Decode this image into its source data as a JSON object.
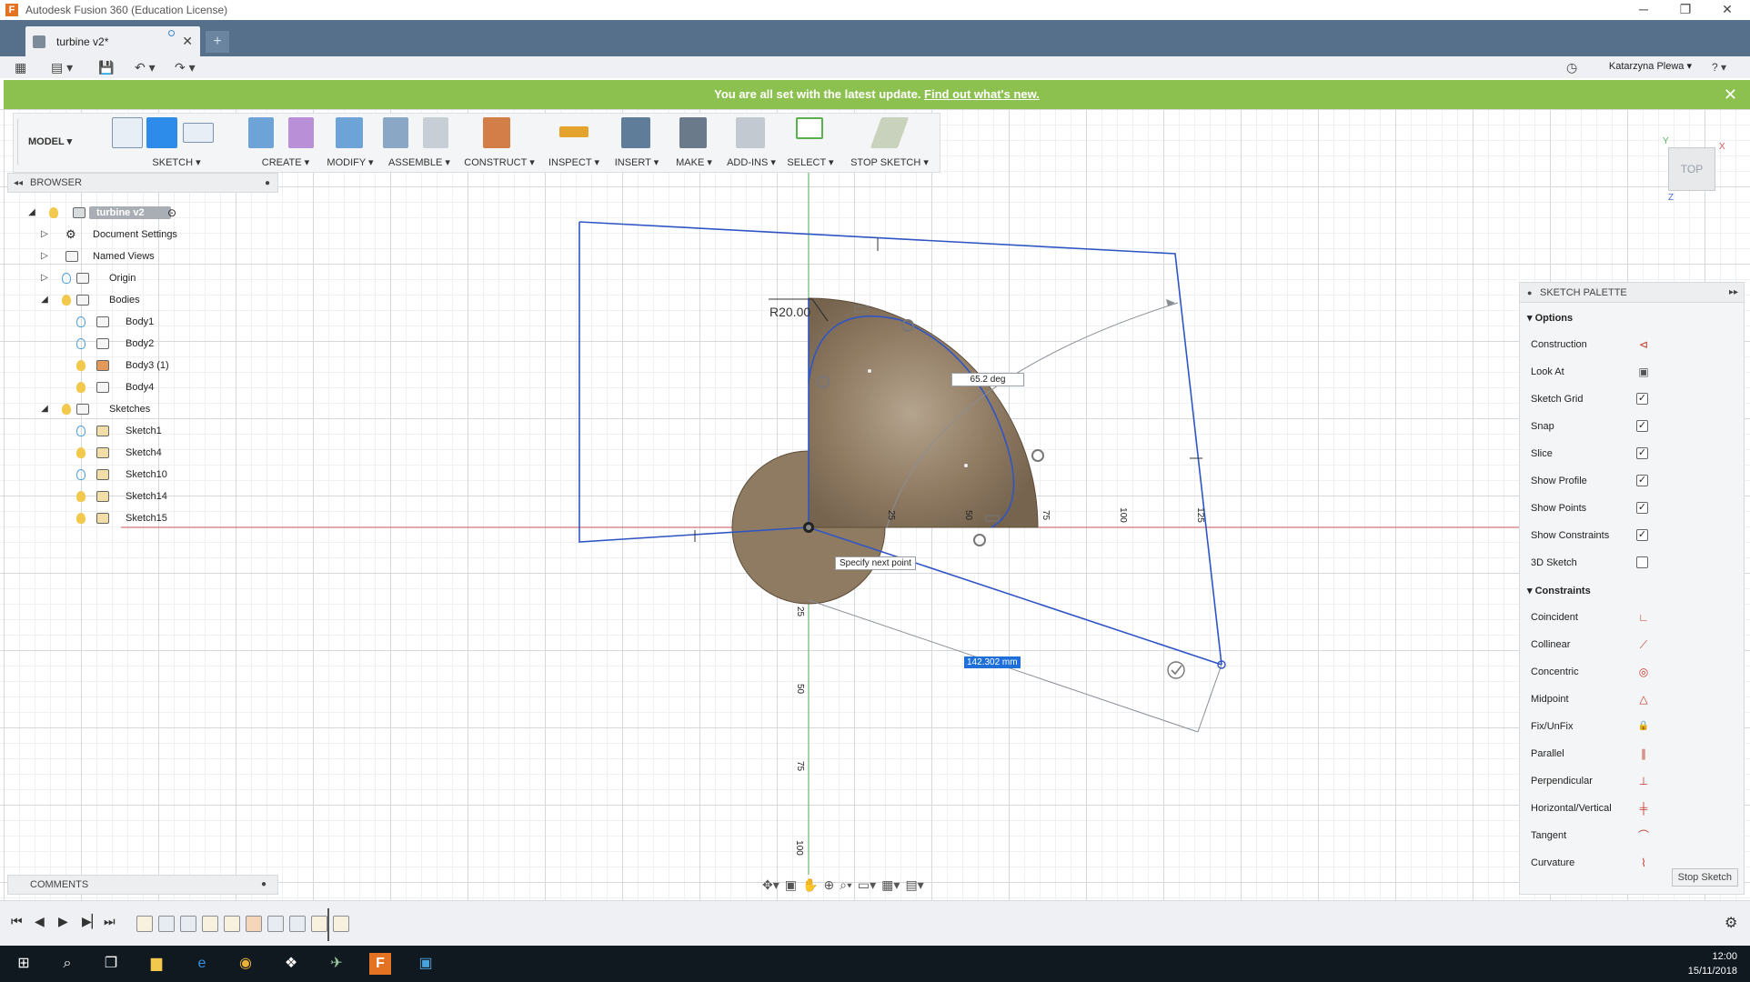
{
  "window": {
    "title": "Autodesk Fusion 360 (Education License)",
    "app_icon_letter": "F",
    "minimize": "─",
    "maximize": "❐",
    "close": "✕"
  },
  "tabs": [
    {
      "label": "turbine v2*"
    }
  ],
  "newtab_label": "+",
  "user": {
    "name": "Katarzyna Plewa ▾",
    "help": "? ▾"
  },
  "notification": {
    "text": "You are all set with the latest update. ",
    "link": "Find out what's new.",
    "close": "✕"
  },
  "ribbon": {
    "mode": "MODEL ▾",
    "groups": [
      {
        "label": "SKETCH ▾"
      },
      {
        "label": "CREATE ▾"
      },
      {
        "label": "MODIFY ▾"
      },
      {
        "label": "ASSEMBLE ▾"
      },
      {
        "label": "CONSTRUCT ▾"
      },
      {
        "label": "INSPECT ▾"
      },
      {
        "label": "INSERT ▾"
      },
      {
        "label": "MAKE ▾"
      },
      {
        "label": "ADD-INS ▾"
      },
      {
        "label": "SELECT ▾"
      },
      {
        "label": "STOP SKETCH ▾"
      }
    ]
  },
  "browser": {
    "title": "BROWSER",
    "root": "turbine v2",
    "items": [
      {
        "label": "Document Settings"
      },
      {
        "label": "Named Views"
      },
      {
        "label": "Origin"
      },
      {
        "label": "Bodies"
      },
      {
        "label": "Body1"
      },
      {
        "label": "Body2"
      },
      {
        "label": "Body3 (1)"
      },
      {
        "label": "Body4"
      },
      {
        "label": "Sketches"
      },
      {
        "label": "Sketch1"
      },
      {
        "label": "Sketch4"
      },
      {
        "label": "Sketch10"
      },
      {
        "label": "Sketch14"
      },
      {
        "label": "Sketch15"
      }
    ]
  },
  "comments": {
    "title": "COMMENTS"
  },
  "viewcube": {
    "face": "TOP",
    "axis_x": "X",
    "axis_y": "Y",
    "axis_z": "Z"
  },
  "sketch": {
    "radius_label": "R20.00",
    "angle_label": "65.2 deg",
    "tooltip": "Specify next point",
    "length_input": "142.302 mm",
    "ruler_x": [
      "25",
      "50",
      "75",
      "100",
      "125"
    ],
    "ruler_y": [
      "25",
      "50",
      "75",
      "100"
    ]
  },
  "palette": {
    "title": "SKETCH PALETTE",
    "options_header": "Options",
    "options": [
      {
        "label": "Construction",
        "icon": "construction-icon",
        "glyph": "⊲"
      },
      {
        "label": "Look At",
        "icon": "look-at-icon",
        "glyph": "▣"
      },
      {
        "label": "Sketch Grid",
        "checked": true,
        "glyph": "✓"
      },
      {
        "label": "Snap",
        "checked": true,
        "glyph": "✓"
      },
      {
        "label": "Slice",
        "checked": true,
        "glyph": "✓"
      },
      {
        "label": "Show Profile",
        "checked": true,
        "glyph": "✓"
      },
      {
        "label": "Show Points",
        "checked": true,
        "glyph": "✓"
      },
      {
        "label": "Show Constraints",
        "checked": true,
        "glyph": "✓"
      },
      {
        "label": "3D Sketch",
        "checked": false,
        "glyph": ""
      }
    ],
    "constraints_header": "Constraints",
    "constraints": [
      {
        "label": "Coincident",
        "icon": "coincident-icon",
        "glyph": "∟"
      },
      {
        "label": "Collinear",
        "icon": "collinear-icon",
        "glyph": "⟋"
      },
      {
        "label": "Concentric",
        "icon": "concentric-icon",
        "glyph": "◎"
      },
      {
        "label": "Midpoint",
        "icon": "midpoint-icon",
        "glyph": "△"
      },
      {
        "label": "Fix/UnFix",
        "icon": "lock-icon",
        "glyph": "🔒"
      },
      {
        "label": "Parallel",
        "icon": "parallel-icon",
        "glyph": "∥"
      },
      {
        "label": "Perpendicular",
        "icon": "perpendicular-icon",
        "glyph": "⊥"
      },
      {
        "label": "Horizontal/Vertical",
        "icon": "horizontal-vertical-icon",
        "glyph": "╪"
      },
      {
        "label": "Tangent",
        "icon": "tangent-icon",
        "glyph": "⌒"
      },
      {
        "label": "Curvature",
        "icon": "curvature-icon",
        "glyph": "⌇"
      }
    ],
    "stop_button": "Stop Sketch"
  },
  "taskbar": {
    "time": "12:00",
    "date": "15/11/2018"
  },
  "colors": {
    "tabbar": "#56708b",
    "notification": "#8cc04f",
    "sketch_line": "#2f55c4",
    "profile_fill": "#8f7a62",
    "axis_red": "#d35a5a",
    "axis_green": "#54b054"
  }
}
